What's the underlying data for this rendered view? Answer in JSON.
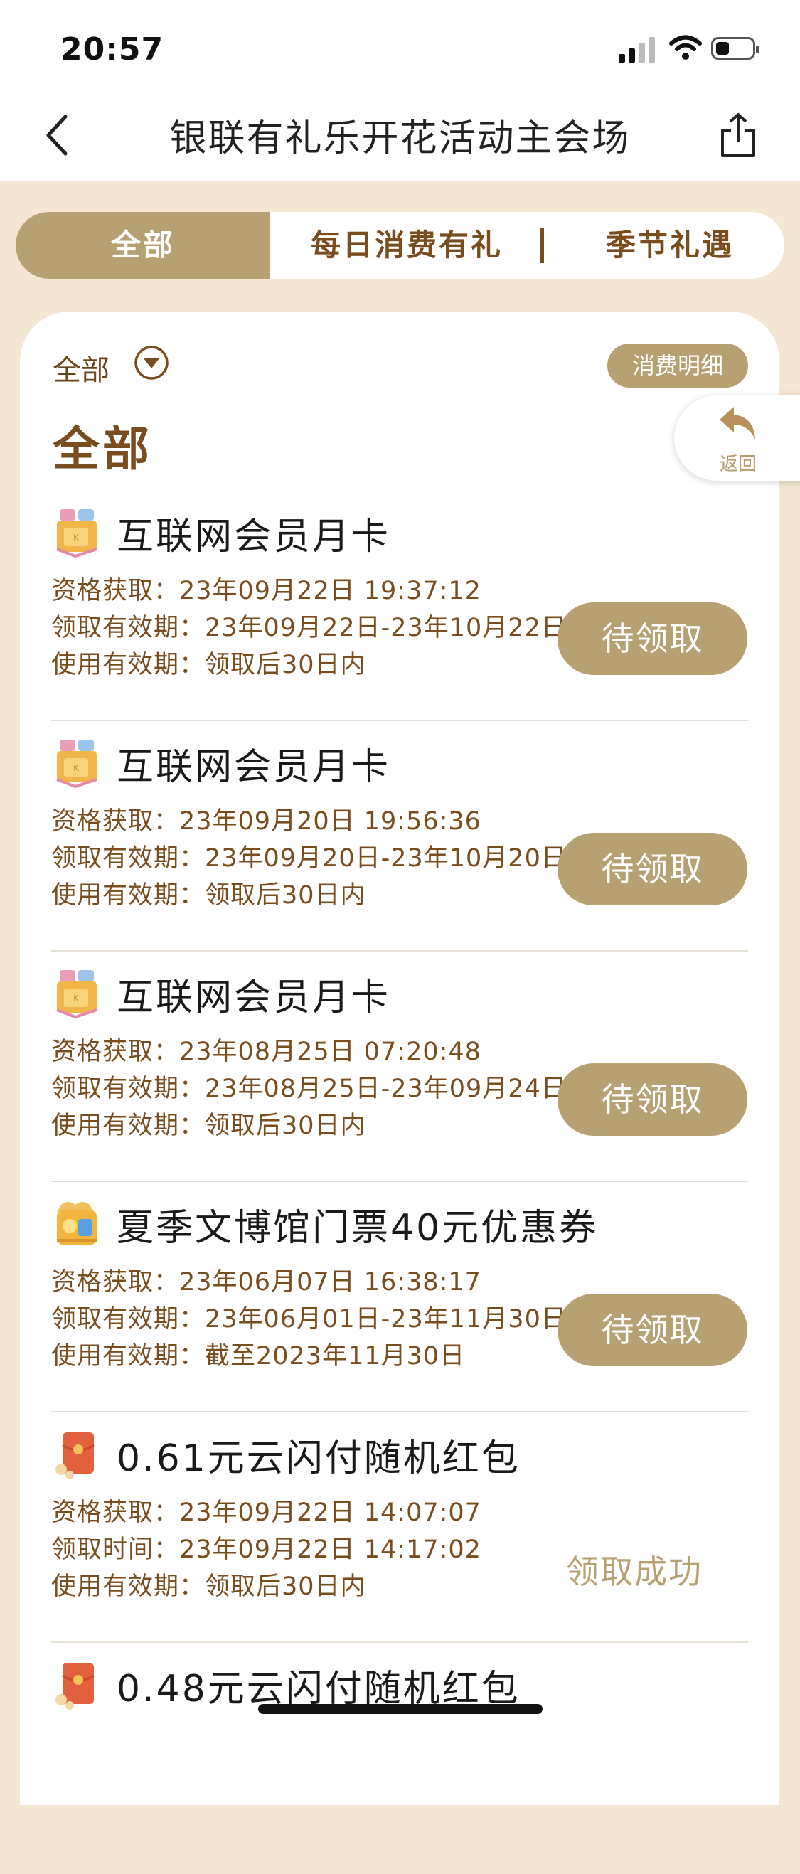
{
  "status": {
    "time": "20:57"
  },
  "nav": {
    "title": "银联有礼乐开花活动主会场"
  },
  "tabs": [
    {
      "label": "全部",
      "active": true
    },
    {
      "label": "每日消费有礼",
      "active": false
    },
    {
      "label": "季节礼遇",
      "active": false
    }
  ],
  "filter": {
    "label": "全部"
  },
  "detail_button": "消费明细",
  "section_title": "全部",
  "return_button": "返回",
  "items": [
    {
      "name": "互联网会员月卡",
      "icon": "gift-box-icon",
      "line1": "资格获取：23年09月22日 19:37:12",
      "line2": "领取有效期：23年09月22日-23年10月22日",
      "line3": "使用有效期：领取后30日内",
      "action": "待领取"
    },
    {
      "name": "互联网会员月卡",
      "icon": "gift-box-icon",
      "line1": "资格获取：23年09月20日 19:56:36",
      "line2": "领取有效期：23年09月20日-23年10月20日",
      "line3": "使用有效期：领取后30日内",
      "action": "待领取"
    },
    {
      "name": "互联网会员月卡",
      "icon": "gift-box-icon",
      "line1": "资格获取：23年08月25日 07:20:48",
      "line2": "领取有效期：23年08月25日-23年09月24日",
      "line3": "使用有效期：领取后30日内",
      "action": "待领取"
    },
    {
      "name": "夏季文博馆门票40元优惠券",
      "icon": "coupon-bag-icon",
      "line1": "资格获取：23年06月07日 16:38:17",
      "line2": "领取有效期：23年06月01日-23年11月30日",
      "line3": "使用有效期：截至2023年11月30日",
      "action": "待领取"
    },
    {
      "name": "0.61元云闪付随机红包",
      "icon": "red-envelope-icon",
      "line1": "资格获取：23年09月22日 14:07:07",
      "line2": "领取时间：23年09月22日 14:17:02",
      "line3": "使用有效期：领取后30日内",
      "status": "领取成功"
    },
    {
      "name": "0.48元云闪付随机红包",
      "icon": "red-envelope-icon"
    }
  ],
  "colors": {
    "accent": "#b7a072",
    "brown": "#7a4d1f",
    "background": "#f3e6d2"
  }
}
